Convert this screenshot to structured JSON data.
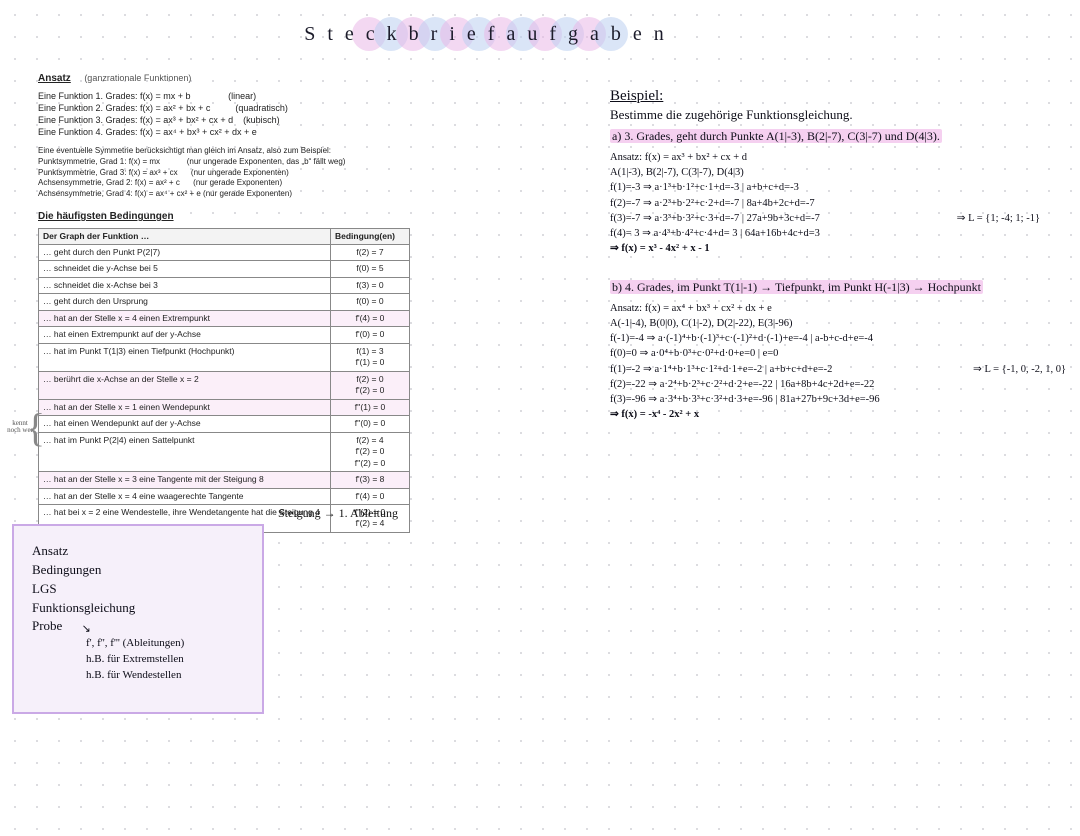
{
  "title": "Steckbriefaufgaben",
  "ansatz_heading": "Ansatz",
  "ansatz_sub": "(ganzrationale Funktionen)",
  "ansatz_lines": [
    "Eine Funktion 1. Grades: f(x) = mx + b               (linear)",
    "Eine Funktion 2. Grades: f(x) = ax² + bx + c          (quadratisch)",
    "Eine Funktion 3. Grades: f(x) = ax³ + bx² + cx + d    (kubisch)",
    "Eine Funktion 4. Grades: f(x) = ax⁴ + bx³ + cx² + dx + e"
  ],
  "sym_intro": "Eine eventuelle Symmetrie berücksichtigt man gleich im Ansatz, also zum Beispiel:",
  "sym_lines": [
    "Punktsymmetrie, Grad 1: f(x) = mx            (nur ungerade Exponenten, das „b“ fällt weg)",
    "Punktsymmetrie, Grad 3: f(x) = ax³ + cx      (nur ungerade Exponenten)",
    "Achsensymmetrie, Grad 2: f(x) = ax² + c      (nur gerade Exponenten)",
    "Achsensymmetrie, Grad 4: f(x) = ax⁴ + cx² + e (nur gerade Exponenten)"
  ],
  "table_heading": "Die häufigsten Bedingungen",
  "table_header_left": "Der Graph der Funktion …",
  "table_header_right": "Bedingung(en)",
  "table_rows": [
    {
      "l": "… geht durch den Punkt P(2|7)",
      "r": "f(2) = 7"
    },
    {
      "l": "… schneidet die y-Achse bei 5",
      "r": "f(0) = 5"
    },
    {
      "l": "… schneidet die x-Achse bei 3",
      "r": "f(3) = 0"
    },
    {
      "l": "… geht durch den Ursprung",
      "r": "f(0) = 0"
    },
    {
      "l": "… hat an der Stelle x = 4 einen Extrempunkt",
      "r": "f'(4) = 0",
      "hl": true
    },
    {
      "l": "… hat einen Extrempunkt auf der y-Achse",
      "r": "f'(0) = 0"
    },
    {
      "l": "… hat im Punkt T(1|3) einen Tiefpunkt (Hochpunkt)",
      "r": "f(1) = 3\nf'(1) = 0"
    },
    {
      "l": "… berührt die x-Achse an der Stelle x = 2",
      "r": "f(2) = 0\nf'(2) = 0",
      "hl": true
    },
    {
      "l": "… hat an der Stelle x = 1 einen Wendepunkt",
      "r": "f''(1) = 0",
      "hl": true
    },
    {
      "l": "… hat einen Wendepunkt auf der y-Achse",
      "r": "f''(0) = 0"
    },
    {
      "l": "… hat im Punkt P(2|4) einen Sattelpunkt",
      "r": "f(2) = 4\nf'(2) = 0\nf''(2) = 0"
    },
    {
      "l": "… hat an der Stelle x = 3 eine Tangente mit der Steigung 8",
      "r": "f'(3) = 8",
      "hl": true
    },
    {
      "l": "… hat an der Stelle x = 4 eine waagerechte Tangente",
      "r": "f'(4) = 0"
    },
    {
      "l": "… hat bei x = 2 eine Wendestelle, ihre Wendetangente hat die Steigung 4",
      "r": "f''(2) = 0\nf'(2) = 4"
    }
  ],
  "side_note": "kennt noch wer",
  "steigung_note": "Steigung → 1. Ableitung",
  "steps": {
    "l1": "Ansatz",
    "l2": "Bedingungen",
    "l3": "LGS",
    "l4": "Funktionsgleichung",
    "l5": "Probe",
    "l5a": "f', f'', f''' (Ableitungen)",
    "l5b": "h.B. für Extremstellen",
    "l5c": "h.B. für Wendestellen"
  },
  "example": {
    "head": "Beispiel:",
    "task": "Bestimme die zugehörige Funktionsgleichung.",
    "a_desc": "a) 3. Grades, geht durch Punkte A(1|-3), B(2|-7), C(3|-7) und D(4|3).",
    "a_lines": [
      "Ansatz: f(x) = ax³ + bx² + cx + d",
      "A(1|-3), B(2|-7), C(3|-7), D(4|3)",
      "f(1)=-3 ⇒ a·1³+b·1²+c·1+d=-3   | a+b+c+d=-3",
      "f(2)=-7 ⇒ a·2³+b·2²+c·2+d=-7   | 8a+4b+2c+d=-7",
      "f(3)=-7 ⇒ a·3³+b·3²+c·3+d=-7   | 27a+9b+3c+d=-7",
      "f(4)= 3 ⇒ a·4³+b·4²+c·4+d= 3   | 64a+16b+4c+d=3",
      "⇒ L = {1; -4; 1; -1}",
      "⇒ f(x) = x³ - 4x² + x - 1"
    ],
    "b_desc": "b) 4. Grades, im Punkt T(1|-1) → Tiefpunkt, im Punkt H(-1|3) → Hochpunkt",
    "b_lines": [
      "Ansatz: f(x) = ax⁴ + bx³ + cx² + dx + e",
      "A(-1|-4), B(0|0), C(1|-2), D(2|-22), E(3|-96)",
      "f(-1)=-4 ⇒ a·(-1)⁴+b·(-1)³+c·(-1)²+d·(-1)+e=-4  | a-b+c-d+e=-4",
      "f(0)=0  ⇒ a·0⁴+b·0³+c·0²+d·0+e=0               | e=0",
      "f(1)=-2 ⇒ a·1⁴+b·1³+c·1²+d·1+e=-2             | a+b+c+d+e=-2",
      "f(2)=-22 ⇒ a·2⁴+b·2³+c·2²+d·2+e=-22           | 16a+8b+4c+2d+e=-22",
      "f(3)=-96 ⇒ a·3⁴+b·3³+c·3²+d·3+e=-96           | 81a+27b+9c+3d+e=-96",
      "⇒ L = {-1, 0, -2, 1, 0}",
      "⇒ f(x) = -x⁴ - 2x² + x"
    ]
  }
}
